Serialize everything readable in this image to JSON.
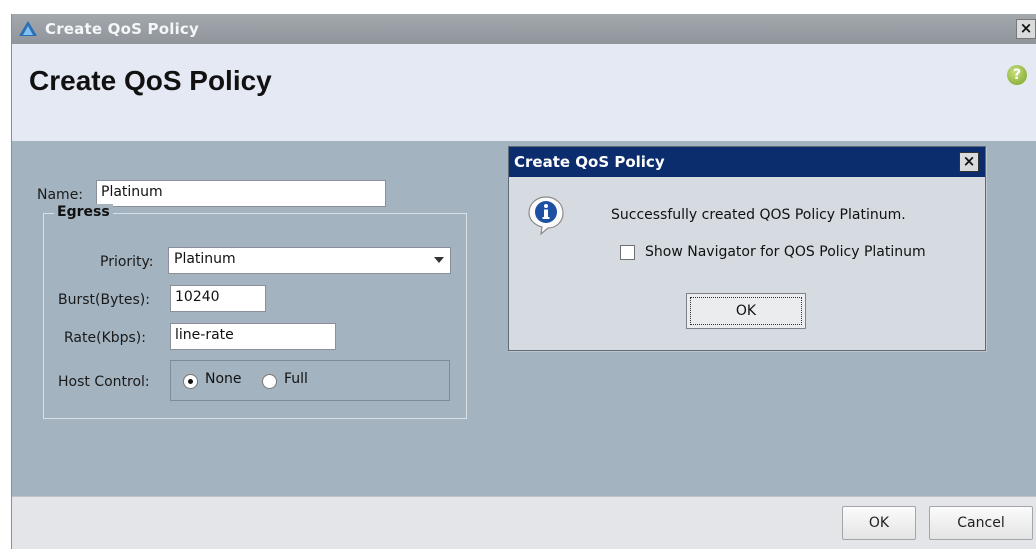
{
  "window": {
    "title": "Create QoS Policy",
    "close_label": "×"
  },
  "header": {
    "title": "Create QoS Policy",
    "help_label": "?"
  },
  "form": {
    "name_label": "Name:",
    "name_value": "Platinum",
    "egress_label": "Egress",
    "priority_label": "Priority:",
    "priority_value": "Platinum",
    "burst_label": "Burst(Bytes):",
    "burst_value": "10240",
    "rate_label": "Rate(Kbps):",
    "rate_value": "line-rate",
    "host_control_label": "Host Control:",
    "host_options": [
      {
        "label": "None",
        "selected": true
      },
      {
        "label": "Full",
        "selected": false
      }
    ]
  },
  "footer": {
    "ok_label": "OK",
    "cancel_label": "Cancel"
  },
  "message_dialog": {
    "title": "Create QoS Policy",
    "close_label": "×",
    "message": "Successfully created QOS Policy Platinum.",
    "checkbox_label": "Show Navigator for QOS Policy Platinum",
    "checkbox_checked": false,
    "ok_label": "OK"
  },
  "colors": {
    "titlebar": "#959ba1",
    "header_bg": "#e4e9f3",
    "content_bg": "#a3b3c0",
    "dialog_title_bg": "#0b2d6e",
    "footer_bg": "#e3e5e8"
  },
  "icons": {
    "app": "cisco-ucs-icon",
    "help": "help-icon",
    "info": "info-icon"
  }
}
